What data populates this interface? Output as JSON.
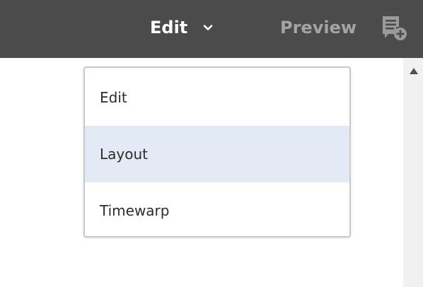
{
  "header": {
    "mode_label": "Edit",
    "preview_label": "Preview",
    "chevron_icon": "chevron-down-icon",
    "annotate_icon": "annotate-icon"
  },
  "mode_menu": {
    "items": [
      {
        "label": "Edit"
      },
      {
        "label": "Layout",
        "highlighted": true
      },
      {
        "label": "Timewarp"
      }
    ]
  },
  "colors": {
    "toolbar_bg": "#4b4b4b",
    "highlight_bg": "#e3e9f5"
  }
}
